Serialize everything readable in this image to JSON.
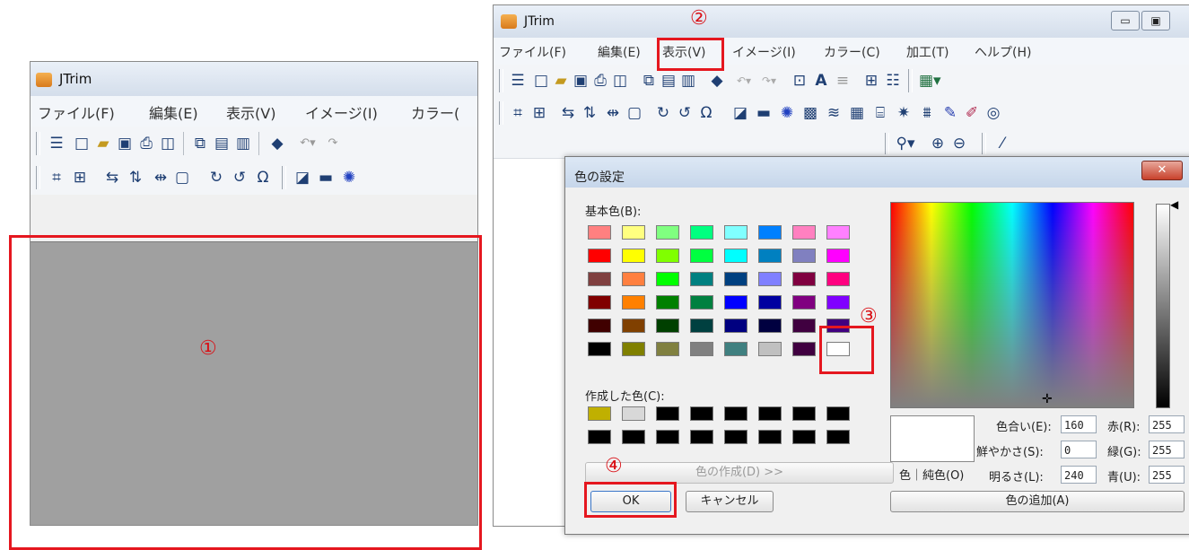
{
  "left_window": {
    "title": "JTrim",
    "menu": [
      "ファイル(F)",
      "編集(E)",
      "表示(V)",
      "イメージ(I)",
      "カラー("
    ],
    "canvas_color": "#a0a0a0"
  },
  "right_window": {
    "title": "JTrim",
    "menu": [
      "ファイル(F)",
      "編集(E)",
      "表示(V)",
      "イメージ(I)",
      "カラー(C)",
      "加工(T)",
      "ヘルプ(H)"
    ]
  },
  "markers": {
    "m1": "①",
    "m2": "②",
    "m3": "③",
    "m4": "④"
  },
  "color_dialog": {
    "title": "色の設定",
    "close_glyph": "✕",
    "basic_colors_label": "基本色(B):",
    "custom_colors_label": "作成した色(C):",
    "define_custom_button": "色の作成(D) >>",
    "ok_button": "OK",
    "cancel_button": "キャンセル",
    "color_solid_label": "色｜純色(O)",
    "add_custom_button": "色の追加(A)",
    "hue_label": "色合い(E):",
    "hue_value": "160",
    "sat_label": "鮮やかさ(S):",
    "sat_value": "0",
    "lum_label": "明るさ(L):",
    "lum_value": "240",
    "red_label": "赤(R):",
    "red_value": "255",
    "green_label": "緑(G):",
    "green_value": "255",
    "blue_label": "青(U):",
    "blue_value": "255",
    "basic_colors": [
      [
        "#ff8080",
        "#ffff80",
        "#80ff80",
        "#00ff80",
        "#80ffff",
        "#0080ff",
        "#ff80c0",
        "#ff80ff"
      ],
      [
        "#ff0000",
        "#ffff00",
        "#80ff00",
        "#00ff40",
        "#00ffff",
        "#0080c0",
        "#8080c0",
        "#ff00ff"
      ],
      [
        "#804040",
        "#ff8040",
        "#00ff00",
        "#008080",
        "#004080",
        "#8080ff",
        "#800040",
        "#ff0080"
      ],
      [
        "#800000",
        "#ff8000",
        "#008000",
        "#008040",
        "#0000ff",
        "#0000a0",
        "#800080",
        "#8000ff"
      ],
      [
        "#400000",
        "#804000",
        "#004000",
        "#004040",
        "#000080",
        "#000040",
        "#400040",
        "#400080"
      ],
      [
        "#000000",
        "#808000",
        "#808040",
        "#808080",
        "#408080",
        "#c0c0c0",
        "#400040",
        "#ffffff"
      ]
    ],
    "custom_colors": [
      [
        "#c0b000",
        "#d8d8d8",
        "#000000",
        "#000000",
        "#000000",
        "#000000",
        "#000000",
        "#000000"
      ],
      [
        "#000000",
        "#000000",
        "#000000",
        "#000000",
        "#000000",
        "#000000",
        "#000000",
        "#000000"
      ]
    ]
  },
  "icons_row1": [
    "properties-icon",
    "new-icon",
    "open-icon",
    "save-icon",
    "print-icon",
    "preview-icon",
    "copy-icon",
    "paste-icon",
    "paste-new-icon",
    "fill-icon",
    "undo-icon",
    "redo-icon"
  ],
  "icons_row2": [
    "crop-icon",
    "resize-icon",
    "flip-h-icon",
    "flip-v-icon",
    "shift-icon",
    "frame-icon",
    "rotate90-icon",
    "rotate-90-icon",
    "rotate-free-icon"
  ]
}
